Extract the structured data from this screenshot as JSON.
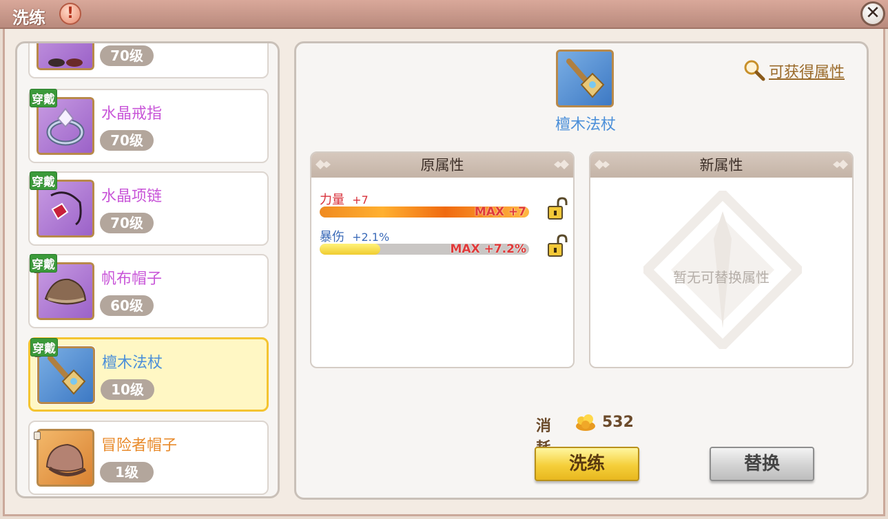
{
  "window": {
    "title": "洗练"
  },
  "items": [
    {
      "name": "",
      "level": "70级",
      "worn": false,
      "badge": "",
      "icon": "gear-icon",
      "color": "purple"
    },
    {
      "name": "水晶戒指",
      "level": "70级",
      "worn": true,
      "badge": "穿戴",
      "icon": "ring-icon",
      "color": "purple"
    },
    {
      "name": "水晶项链",
      "level": "70级",
      "worn": true,
      "badge": "穿戴",
      "icon": "necklace-icon",
      "color": "purple"
    },
    {
      "name": "帆布帽子",
      "level": "60级",
      "worn": true,
      "badge": "穿戴",
      "icon": "hat-icon",
      "color": "purple"
    },
    {
      "name": "檀木法杖",
      "level": "10级",
      "worn": true,
      "badge": "穿戴",
      "icon": "staff-icon",
      "color": "blue",
      "selected": true
    },
    {
      "name": "冒险者帽子",
      "level": "1级",
      "worn": false,
      "badge": "",
      "icon": "hat-icon",
      "color": "orange"
    }
  ],
  "selected": {
    "name": "檀木法杖",
    "obtainable_link": "可获得属性"
  },
  "original_attrs": {
    "header": "原属性",
    "rows": [
      {
        "label": "力量",
        "value": "+7",
        "max_text": "MAX +7",
        "fill": 1.0
      },
      {
        "label": "暴伤",
        "value": "+2.1%",
        "max_text": "MAX +7.2%",
        "fill": 0.29
      }
    ]
  },
  "new_attrs": {
    "header": "新属性",
    "empty_text": "暂无可替换属性"
  },
  "cost": {
    "label": "消耗",
    "value": "532"
  },
  "buttons": {
    "refine": "洗练",
    "replace": "替换"
  },
  "colors": {
    "accent_gold": "#f5cf3a",
    "name_purple": "#c855d8",
    "name_blue": "#4b8fd9",
    "name_orange": "#e88a2a",
    "max_red": "#e03a3a"
  }
}
